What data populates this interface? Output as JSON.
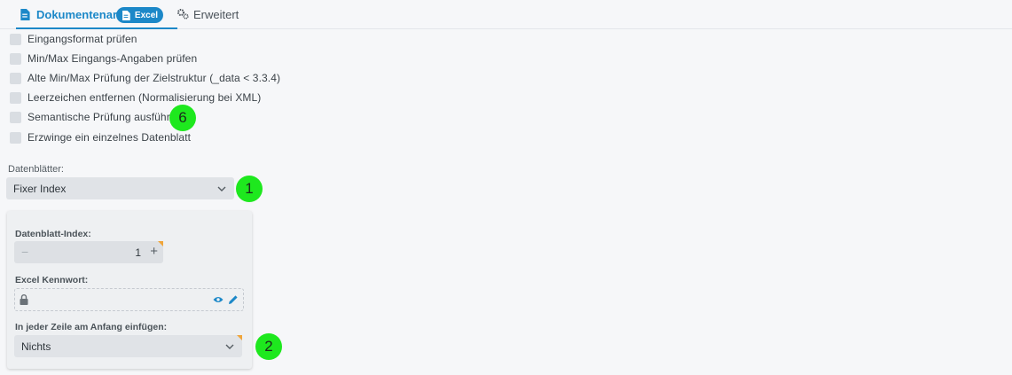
{
  "tabs": {
    "document_type": "Dokumentenart",
    "excel_badge": "Excel",
    "extended": "Erweitert"
  },
  "checkboxes": [
    {
      "label": "Eingangsformat prüfen",
      "checked": false
    },
    {
      "label": "Min/Max Eingangs-Angaben prüfen",
      "checked": false
    },
    {
      "label": "Alte Min/Max Prüfung der Zielstruktur (_data < 3.3.4)",
      "checked": false
    },
    {
      "label": "Leerzeichen entfernen (Normalisierung bei XML)",
      "checked": false
    },
    {
      "label": "Semantische Prüfung ausführen",
      "checked": false
    },
    {
      "label": "Erzwinge ein einzelnes Datenblatt",
      "checked": false
    }
  ],
  "datasheets": {
    "label": "Datenblätter:",
    "selected": "Fixer Index"
  },
  "panel": {
    "index_label": "Datenblatt-Index:",
    "index_value": "1",
    "minus": "−",
    "plus": "+",
    "password_label": "Excel Kennwort:",
    "insert_label": "In jeder Zeile am Anfang einfügen:",
    "insert_selected": "Nichts"
  },
  "markers": [
    "6",
    "1",
    "2"
  ],
  "colors": {
    "accent": "#1c88c8",
    "marker": "#1ee81e",
    "modified_corner": "#f0a53a"
  },
  "icons": [
    "file-icon",
    "settings-icon",
    "lock-icon",
    "eye-icon",
    "pencil-icon",
    "chevron-down-icon"
  ]
}
